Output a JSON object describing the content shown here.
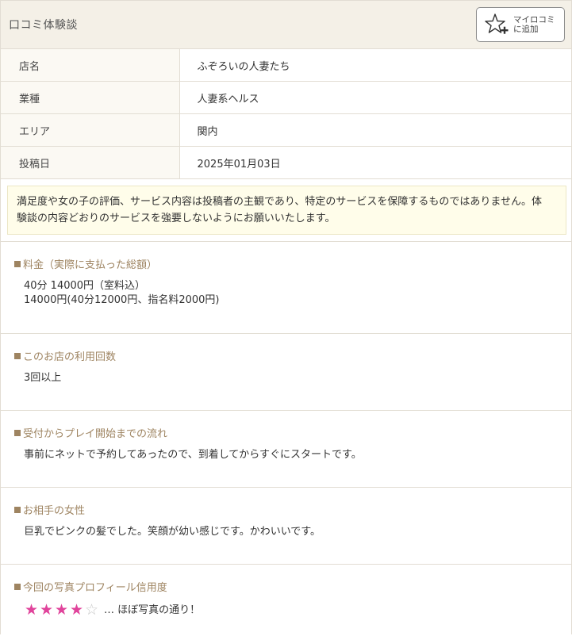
{
  "header": {
    "title": "口コミ体験談",
    "add_button_line1": "マイロコミ",
    "add_button_line2": "に追加"
  },
  "info": [
    {
      "label": "店名",
      "value": "ふぞろいの人妻たち"
    },
    {
      "label": "業種",
      "value": "人妻系ヘルス"
    },
    {
      "label": "エリア",
      "value": "関内"
    },
    {
      "label": "投稿日",
      "value": "2025年01月03日"
    }
  ],
  "notice": {
    "line1": "満足度や女の子の評価、サービス内容は投稿者の主観であり、特定のサービスを保障するものではありません。体",
    "line2": "験談の内容どおりのサービスを強要しないようにお願いいたします。"
  },
  "sections": {
    "price": {
      "title": "料金（実際に支払った総額）",
      "line1": "40分 14000円（室料込）",
      "line2": "14000円(40分12000円、指名料2000円)"
    },
    "visits": {
      "title": "このお店の利用回数",
      "line1": "3回以上"
    },
    "flow": {
      "title": "受付からプレイ開始までの流れ",
      "line1": "事前にネットで予約してあったので、到着してからすぐにスタートです。"
    },
    "partner": {
      "title": "お相手の女性",
      "line1": "巨乳でピンクの髪でした。笑顔が幼い感じです。かわいいです。"
    },
    "photo": {
      "title": "今回の写真プロフィール信用度",
      "rating": 4,
      "rating_max": 5,
      "comment": "… ほぼ写真の通り！"
    }
  },
  "colors": {
    "header_bg": "#f4f0e7",
    "section_title": "#9e8461",
    "star_on": "#e0439b",
    "star_off": "#c9c9c9",
    "notice_bg": "#fffdea"
  },
  "icons": {
    "add_button": "star-plus-icon",
    "section_marker": "square-bullet-icon",
    "rating_star": "star-icon"
  }
}
